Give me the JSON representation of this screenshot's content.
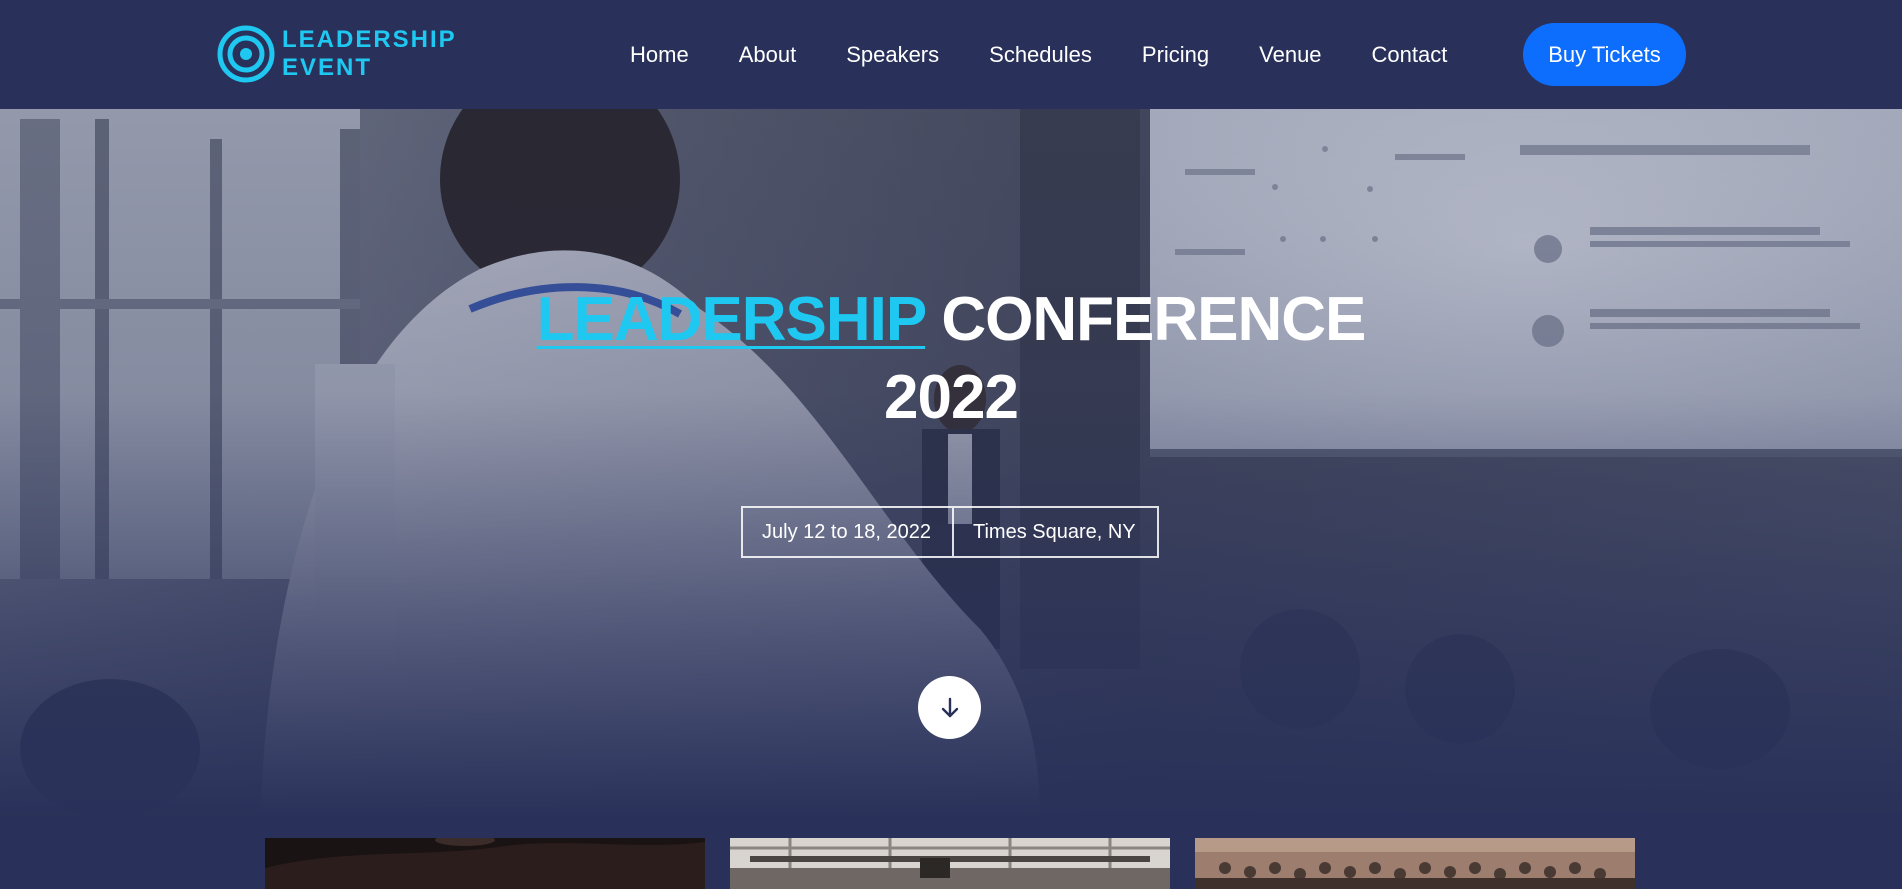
{
  "logo": {
    "line1": "LEADERSHIP",
    "line2": "EVENT",
    "icon": "target-icon"
  },
  "nav": {
    "items": [
      {
        "label": "Home"
      },
      {
        "label": "About"
      },
      {
        "label": "Speakers"
      },
      {
        "label": "Schedules"
      },
      {
        "label": "Pricing"
      },
      {
        "label": "Venue"
      },
      {
        "label": "Contact"
      }
    ],
    "cta_label": "Buy Tickets"
  },
  "hero": {
    "title_accent": "LEADERSHIP",
    "title_rest": "CONFERENCE",
    "title_year": "2022",
    "date": "July 12 to 18, 2022",
    "location": "Times Square, NY",
    "scroll_icon": "arrow-down-icon"
  },
  "colors": {
    "navy": "#29315a",
    "accent": "#1fc8f0",
    "button": "#0d6efd",
    "white": "#ffffff"
  }
}
